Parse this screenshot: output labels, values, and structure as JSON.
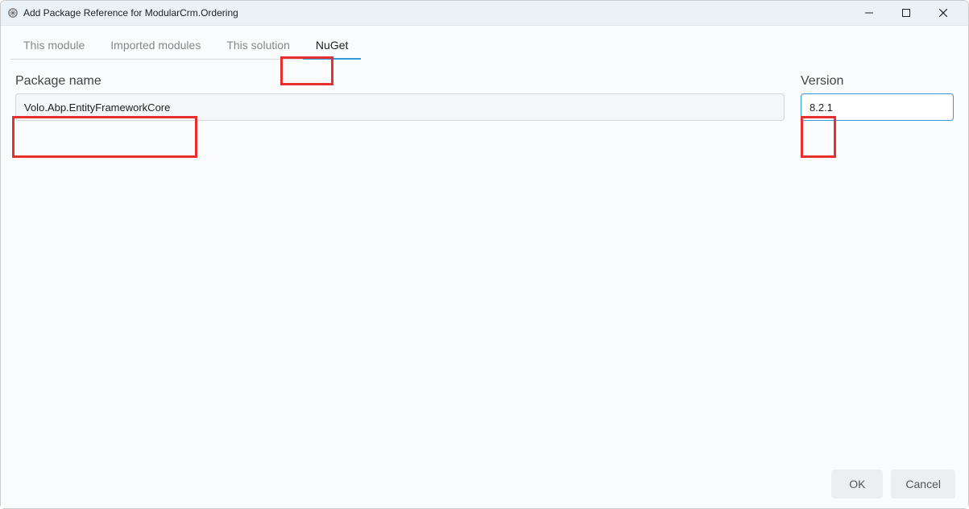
{
  "window": {
    "title": "Add Package Reference for ModularCrm.Ordering"
  },
  "tabs": [
    {
      "label": "This module",
      "active": false
    },
    {
      "label": "Imported modules",
      "active": false
    },
    {
      "label": "This solution",
      "active": false
    },
    {
      "label": "NuGet",
      "active": true
    }
  ],
  "form": {
    "package_label": "Package name",
    "package_value": "Volo.Abp.EntityFrameworkCore",
    "version_label": "Version",
    "version_value": "8.2.1"
  },
  "buttons": {
    "ok": "OK",
    "cancel": "Cancel"
  },
  "highlights": {
    "tab_index": 3,
    "package_input": true,
    "version_input": true
  }
}
